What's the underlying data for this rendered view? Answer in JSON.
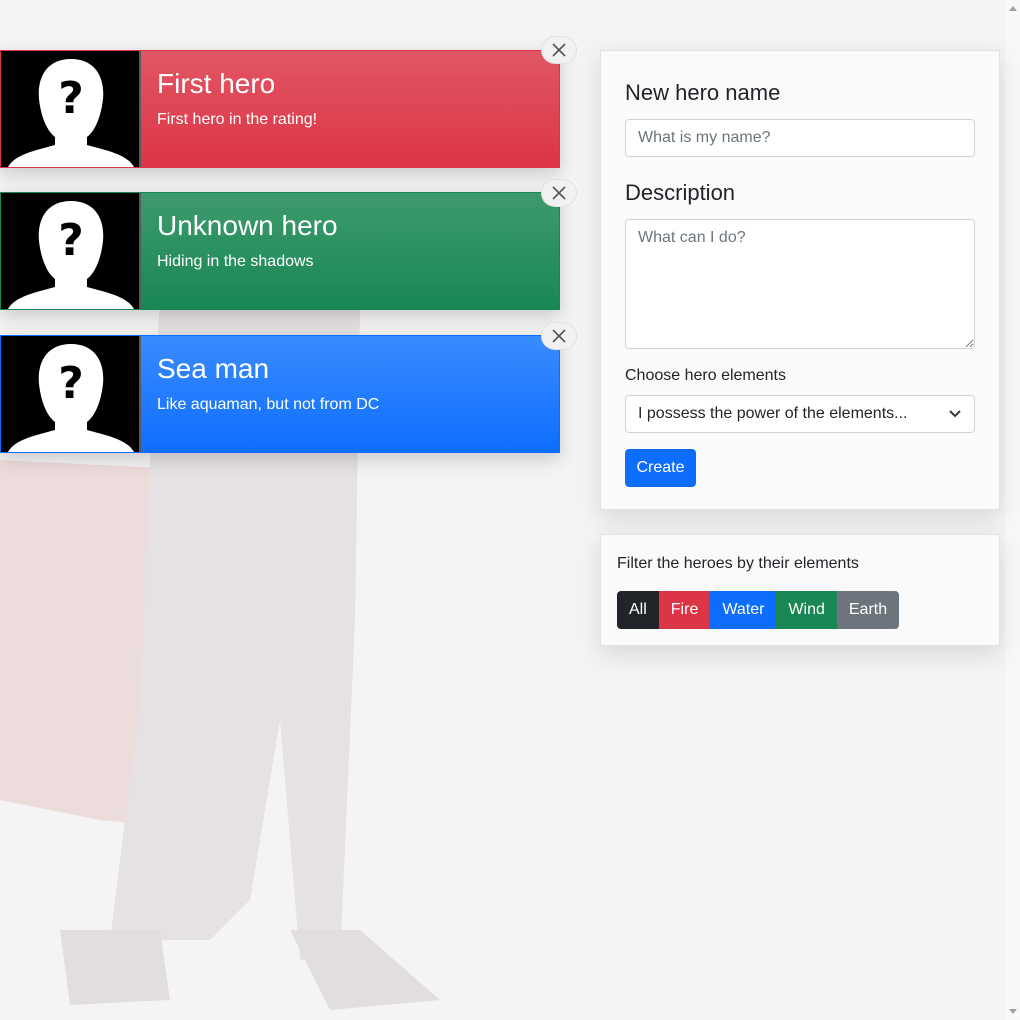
{
  "heroes": [
    {
      "name": "First hero",
      "description": "First hero in the rating!",
      "element": "fire"
    },
    {
      "name": "Unknown hero",
      "description": "Hiding in the shadows",
      "element": "wind"
    },
    {
      "name": "Sea man",
      "description": "Like aquaman, but not from DC",
      "element": "water"
    }
  ],
  "form": {
    "name_label": "New hero name",
    "name_placeholder": "What is my name?",
    "description_label": "Description",
    "description_placeholder": "What can I do?",
    "elements_label": "Choose hero elements",
    "elements_selected": "I possess the power of the elements...",
    "create_label": "Create"
  },
  "filter": {
    "title": "Filter the heroes by their elements",
    "buttons": [
      "All",
      "Fire",
      "Water",
      "Wind",
      "Earth"
    ]
  },
  "colors": {
    "fire": "#dc3545",
    "water": "#0d6efd",
    "wind": "#198754",
    "earth": "#6c757d",
    "all": "#212529"
  },
  "icons": {
    "avatar": "unknown-person-icon",
    "close": "close-icon",
    "select": "chevron-down-icon"
  }
}
